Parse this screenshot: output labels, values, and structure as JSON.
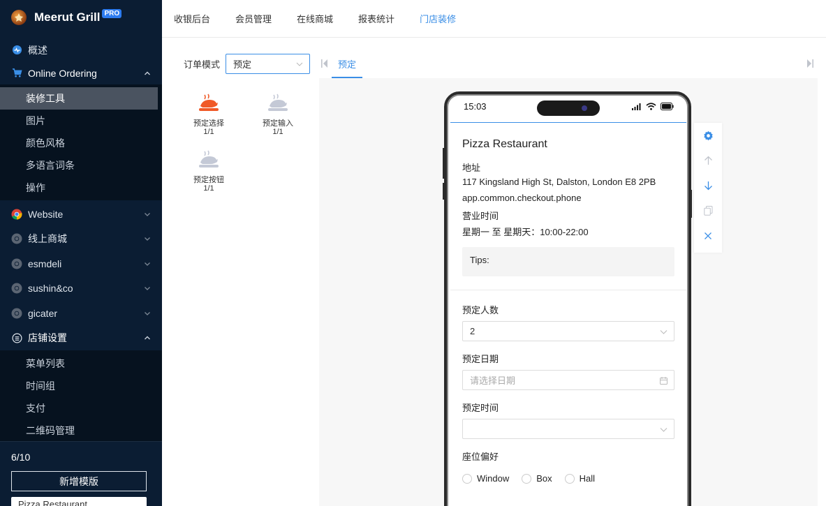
{
  "brand": {
    "name": "Meerut Grill",
    "badge": "PRO"
  },
  "sidebar": {
    "overview": "概述",
    "online_ordering": {
      "label": "Online Ordering",
      "items": [
        "装修工具",
        "图片",
        "颜色风格",
        "多语言词条",
        "操作"
      ],
      "active": "装修工具"
    },
    "sites": [
      "Website",
      "线上商城",
      "esmdeli",
      "sushin&co",
      "gicater"
    ],
    "store_settings": {
      "label": "店铺设置",
      "items": [
        "菜单列表",
        "时间组",
        "支付",
        "二维码管理"
      ]
    },
    "counter": "6/10",
    "add_template": "新增模版",
    "store_select": "Pizza Restaurant"
  },
  "topnav": [
    "收银后台",
    "会员管理",
    "在线商城",
    "报表统计",
    "门店装修"
  ],
  "topnav_active": "门店装修",
  "order_mode": {
    "label": "订单模式",
    "value": "预定"
  },
  "tab": "预定",
  "components": [
    {
      "label": "预定选择",
      "count": "1/1"
    },
    {
      "label": "预定输入",
      "count": "1/1"
    },
    {
      "label": "预定按钮",
      "count": "1/1"
    }
  ],
  "phone": {
    "time": "15:03",
    "restaurant": "Pizza Restaurant",
    "address_label": "地址",
    "address": "117 Kingsland High St, Dalston, London E8 2PB",
    "phone_key": "app.common.checkout.phone",
    "hours_label": "营业时间",
    "hours": "星期一 至 星期天：10:00-22:00",
    "tips": "Tips:",
    "form": {
      "people_label": "预定人数",
      "people_value": "2",
      "date_label": "预定日期",
      "date_placeholder": "请选择日期",
      "time_label": "预定时间",
      "seat_label": "座位偏好",
      "seat_options": [
        "Window",
        "Box",
        "Hall"
      ]
    }
  },
  "colors": {
    "accent": "#3a8ee6",
    "sidebar_bg": "#0b1d33",
    "active_item": "#4a5360",
    "component_active": "#f05a28"
  }
}
